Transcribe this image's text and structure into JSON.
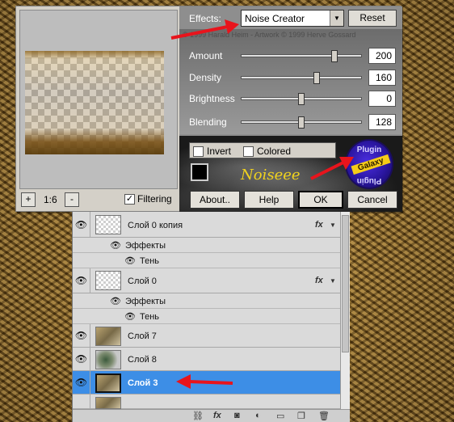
{
  "dialog": {
    "effects_label": "Effects:",
    "effects_value": "Noise Creator",
    "reset_label": "Reset",
    "copyright": "© 1999 Harald Heim - Artwork © 1999 Herve Gossard",
    "sliders": [
      {
        "label": "Amount",
        "value": "200",
        "fraction": 0.78
      },
      {
        "label": "Density",
        "value": "160",
        "fraction": 0.63
      },
      {
        "label": "Brightness",
        "value": "0",
        "fraction": 0.5
      },
      {
        "label": "Blending",
        "value": "128",
        "fraction": 0.5
      }
    ],
    "invert_label": "Invert",
    "colored_label": "Colored",
    "zoom_in": "+",
    "zoom_out": "-",
    "zoom_level": "1:6",
    "filtering_label": "Filtering",
    "filtering_checked": "✓",
    "brand_text": "Noiseee",
    "badge": {
      "top": "Plugin",
      "middle": "Galaxy",
      "bottom": "Plugin"
    },
    "about_label": "About..",
    "help_label": "Help",
    "ok_label": "OK",
    "cancel_label": "Cancel"
  },
  "layers": {
    "rows": [
      {
        "name": "Слой 0 копия",
        "fx": "fx"
      },
      {
        "name": "Слой 0",
        "fx": "fx"
      },
      {
        "name": "Слой 7"
      },
      {
        "name": "Слой 8"
      },
      {
        "name": "Слой 3"
      }
    ],
    "effects_label": "Эффекты",
    "shadow_label": "Тень"
  },
  "colors": {
    "selection": "#3d8ee6",
    "arrow": "#e8141c"
  }
}
